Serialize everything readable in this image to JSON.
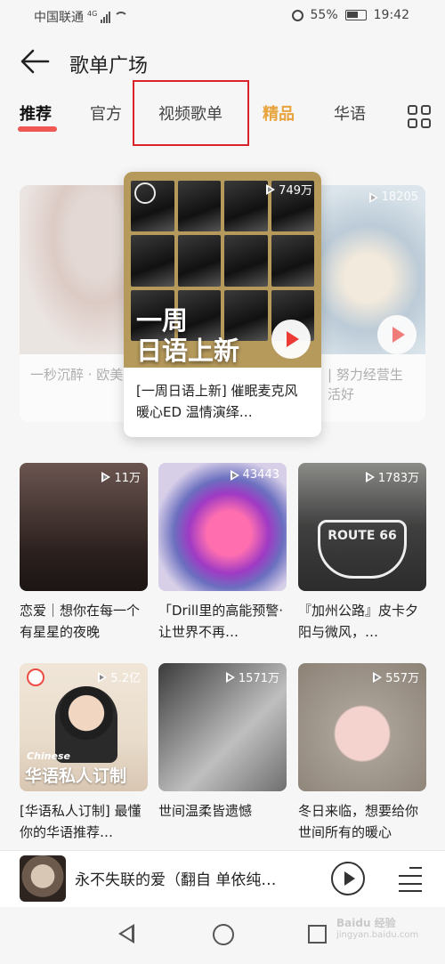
{
  "status": {
    "carrier": "中国联通",
    "network": "4G",
    "battery": "55%",
    "time": "19:42"
  },
  "header": {
    "title": "歌单广场"
  },
  "tabs": [
    {
      "label": "推荐"
    },
    {
      "label": "官方"
    },
    {
      "label": "视频歌单"
    },
    {
      "label": "精品"
    },
    {
      "label": "华语"
    }
  ],
  "carousel": {
    "left": {
      "title": "一秒沉醉 · 欧美嗓"
    },
    "center": {
      "plays": "749万",
      "overlay": "一周\n日语上新",
      "title": "[一周日语上新] 催眠麦克风暖心ED 温情演绎…"
    },
    "right": {
      "plays": "18205",
      "title": "| 努力经营生活好"
    }
  },
  "playlists": [
    {
      "plays": "11万",
      "title": "恋爱｜想你在每一个有星星的夜晚"
    },
    {
      "plays": "43443",
      "title": "「Drill里的高能预警·让世界不再…"
    },
    {
      "plays": "1783万",
      "title": "『加州公路』皮卡夕阳与微风，…",
      "art_text": "ROUTE 66"
    },
    {
      "plays": "5.2亿",
      "title": "[华语私人订制] 最懂你的华语推荐…",
      "art_small": "Chinese",
      "art_big": "华语私人订制"
    },
    {
      "plays": "1571万",
      "title": "世间温柔皆遗憾"
    },
    {
      "plays": "557万",
      "title": "冬日来临，想要给你世间所有的暖心"
    }
  ],
  "player": {
    "song": "永不失联的爱（翻自 单依纯…"
  },
  "watermark": {
    "main": "Baidu 经验",
    "sub": "jingyan.baidu.com"
  },
  "colors": {
    "accent_red": "#ec3b35",
    "gold_tab": "#e8a33c",
    "highlight_box": "#d8232a"
  }
}
